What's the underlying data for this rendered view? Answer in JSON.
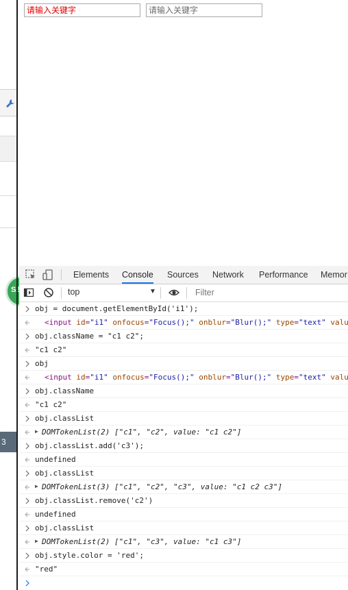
{
  "page": {
    "input1_value": "请输入关键字",
    "input2_placeholder": "请输入关键字"
  },
  "behind_window": {
    "badge_text": "SZ",
    "dark_block_text": "3"
  },
  "devtools": {
    "tabs": [
      "Elements",
      "Console",
      "Sources",
      "Network",
      "Performance",
      "Memor"
    ],
    "active_tab": "Console",
    "context": "top",
    "filter_placeholder": "Filter"
  },
  "console": {
    "entries": [
      {
        "kind": "in",
        "text": "obj = document.getElementById('i1');"
      },
      {
        "kind": "out-el",
        "tag_open": "<",
        "tag": "input",
        "attrs": [
          {
            "n": "id",
            "v": "\"i1\""
          },
          {
            "n": "onfocus",
            "v": "\"Focus();\""
          },
          {
            "n": "onblur",
            "v": "\"Blur();\""
          },
          {
            "n": "type",
            "v": "\"text\""
          },
          {
            "n": "valu",
            "v": ""
          }
        ]
      },
      {
        "kind": "in",
        "text": "obj.className = \"c1 c2\";"
      },
      {
        "kind": "out-str",
        "text": "\"c1 c2\""
      },
      {
        "kind": "in",
        "text": "obj"
      },
      {
        "kind": "out-el",
        "tag_open": "<",
        "tag": "input",
        "attrs": [
          {
            "n": "id",
            "v": "\"i1\""
          },
          {
            "n": "onfocus",
            "v": "\"Focus();\""
          },
          {
            "n": "onblur",
            "v": "\"Blur();\""
          },
          {
            "n": "type",
            "v": "\"text\""
          },
          {
            "n": "valu",
            "v": ""
          }
        ]
      },
      {
        "kind": "in",
        "text": "obj.className"
      },
      {
        "kind": "out-str",
        "text": "\"c1 c2\""
      },
      {
        "kind": "in",
        "text": "obj.classList"
      },
      {
        "kind": "out-list",
        "text": "DOMTokenList(2) [\"c1\", \"c2\", value: \"c1 c2\"]"
      },
      {
        "kind": "in",
        "text": "obj.classList.add('c3');"
      },
      {
        "kind": "out-undef",
        "text": "undefined"
      },
      {
        "kind": "in",
        "text": "obj.classList"
      },
      {
        "kind": "out-list",
        "text": "DOMTokenList(3) [\"c1\", \"c2\", \"c3\", value: \"c1 c2 c3\"]"
      },
      {
        "kind": "in",
        "text": "obj.classList.remove('c2')"
      },
      {
        "kind": "out-undef",
        "text": "undefined"
      },
      {
        "kind": "in",
        "text": "obj.classList"
      },
      {
        "kind": "out-list",
        "text": "DOMTokenList(2) [\"c1\", \"c3\", value: \"c1 c3\"]"
      },
      {
        "kind": "in",
        "text": "obj.style.color = 'red';"
      },
      {
        "kind": "out-str",
        "text": "\"red\""
      }
    ]
  },
  "colors": {
    "input1_text": "#e00000",
    "active_tab_underline": "#1a73e8",
    "prompt_blue": "#1a73e8"
  }
}
